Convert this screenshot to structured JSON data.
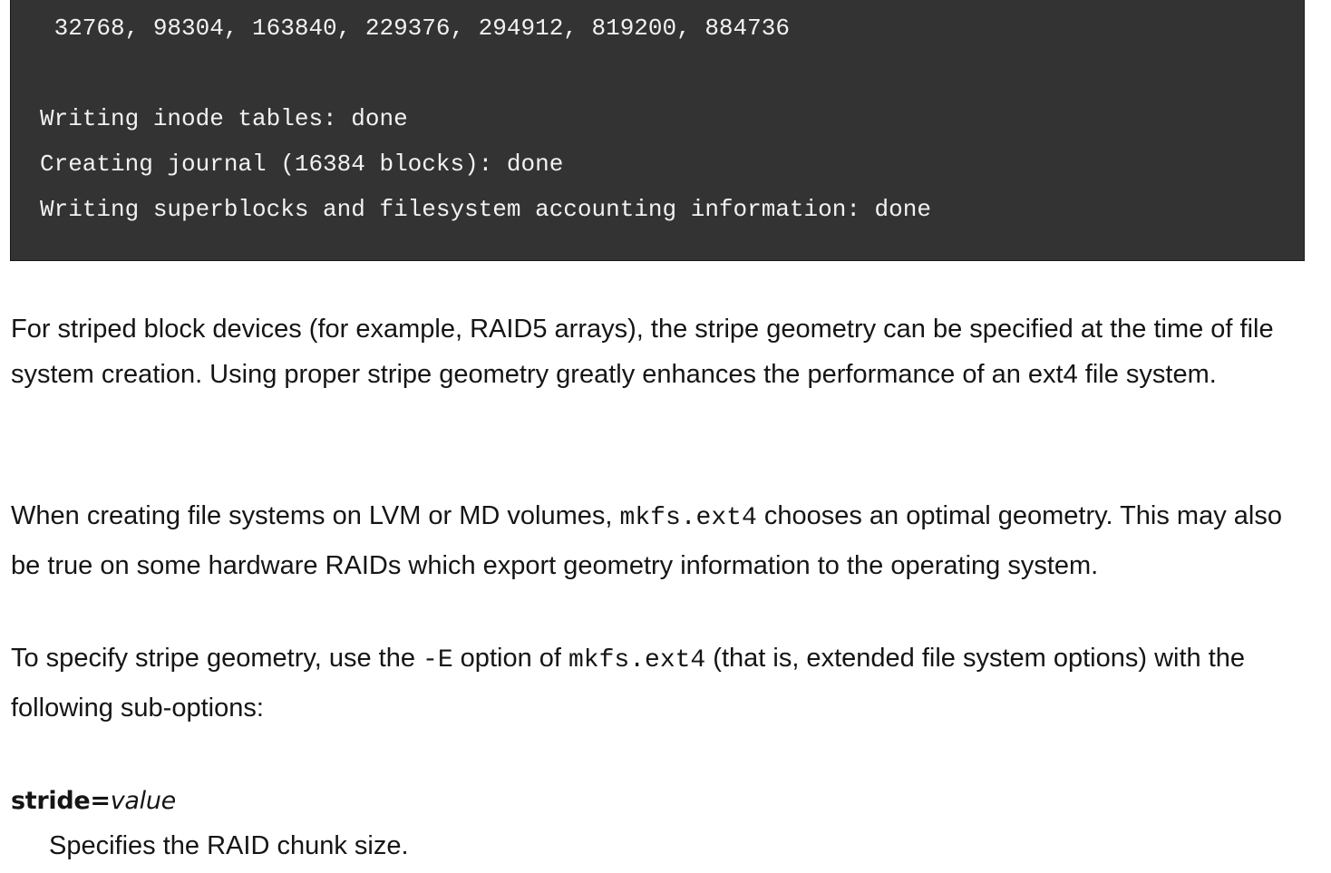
{
  "code_block": {
    "lines": [
      " 32768, 98304, 163840, 229376, 294912, 819200, 884736",
      "",
      "Writing inode tables: done",
      "Creating journal (16384 blocks): done",
      "Writing superblocks and filesystem accounting information: done"
    ]
  },
  "paragraphs": {
    "p1": "For striped block devices (for example, RAID5 arrays), the stripe geometry can be specified at the time of file system creation. Using proper stripe geometry greatly enhances the performance of an ext4 file system.",
    "p2_before": "When creating file systems on LVM or MD volumes, ",
    "p2_code": "mkfs.ext4",
    "p2_after": " choose​s an optimal geometry. This may also be true on some hardware RAIDs which export geometry information to the operating system.",
    "p3_before": "To specify stripe geometry, use the ",
    "p3_code1": "-E",
    "p3_middle": " option of ",
    "p3_code2": "mkfs.ext4",
    "p3_after": " (that is, extended file system options) with the following sub-options:"
  },
  "definition": {
    "term": "stride=",
    "term_value": "value",
    "description": "Specifies the RAID chunk size."
  }
}
